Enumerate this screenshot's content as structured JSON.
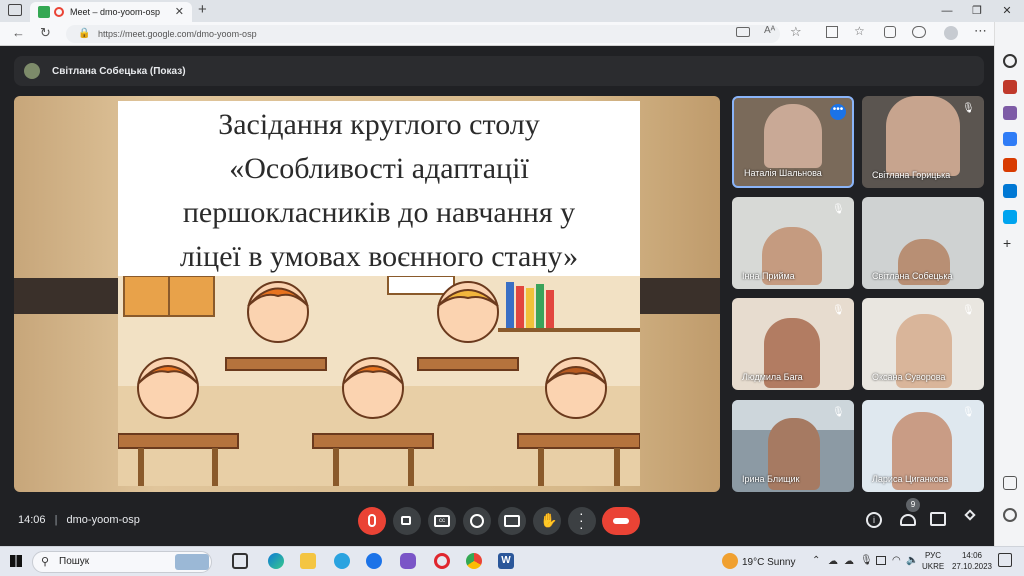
{
  "browser": {
    "tab_title": "Meet – dmo-yoom-osp",
    "url": "https://meet.google.com/dmo-yoom-osp"
  },
  "meet": {
    "presenter_label": "Світлана Собецька (Показ)",
    "slide": {
      "line1": "Засідання круглого столу",
      "line2": "«Особливості адаптації",
      "line3": "першокласників до навчання у",
      "line4": "ліцеї в умовах воєнного стану»"
    },
    "participants": [
      {
        "name": "Наталія Шальнова",
        "muted": false
      },
      {
        "name": "Світлана Горицька",
        "muted": true
      },
      {
        "name": "Інна Прийма",
        "muted": true
      },
      {
        "name": "Світлана Собецька",
        "muted": false
      },
      {
        "name": "Людмила Бага",
        "muted": true
      },
      {
        "name": "Оксана Суворова",
        "muted": true
      },
      {
        "name": "Ірина Блищик",
        "muted": true
      },
      {
        "name": "Лариса Циганкова",
        "muted": true
      }
    ],
    "time": "14:06",
    "meeting_code": "dmo-yoom-osp",
    "people_count": "9"
  },
  "taskbar": {
    "search_label": "Пошук",
    "weather": "19°C  Sunny",
    "lang1": "РУС",
    "lang2": "UKRE",
    "clock_time": "14:06",
    "clock_date": "27.10.2023"
  },
  "colors": {
    "accent_red": "#ea4335",
    "meet_bg": "#202124",
    "active_tile_border": "#8ab4f8"
  }
}
